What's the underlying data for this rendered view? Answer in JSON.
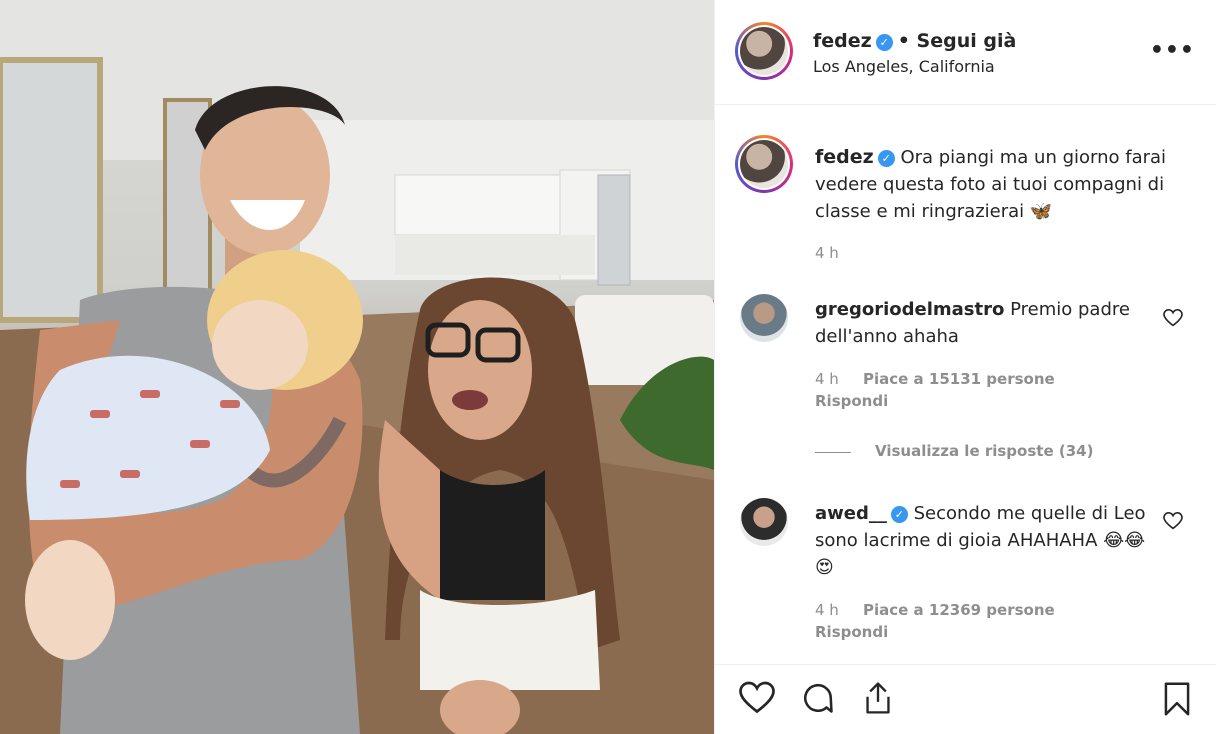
{
  "post": {
    "author": {
      "username": "fedez",
      "verified_icon": "verified-badge-icon",
      "follow_status": "• Segui già",
      "location": "Los Angeles, California"
    },
    "caption": {
      "username": "fedez",
      "text": "Ora piangi ma un giorno farai vedere questa foto ai tuoi compagni di classe e mi ringrazierai 🦋",
      "time": "4 h"
    },
    "comments": [
      {
        "username": "gregoriodelmastro",
        "text": "Premio padre dell'anno ahaha",
        "time": "4 h",
        "likes": "Piace a 15131 persone",
        "reply_label": "Rispondi",
        "view_replies": "Visualizza le risposte (34)"
      },
      {
        "username": "awed__",
        "verified": true,
        "text": "Secondo me quelle di Leo sono lacrime di gioia AHAHAHA 😂😂😍",
        "time": "4 h",
        "likes": "Piace a 12369 persone",
        "reply_label": "Rispondi"
      }
    ],
    "actions": [
      "heart-icon",
      "comment-icon",
      "share-icon",
      "bookmark-icon"
    ]
  },
  "colors": {
    "text": "#262626",
    "muted": "#8e8e8e",
    "verified": "#3897f0",
    "border": "#efefef"
  }
}
